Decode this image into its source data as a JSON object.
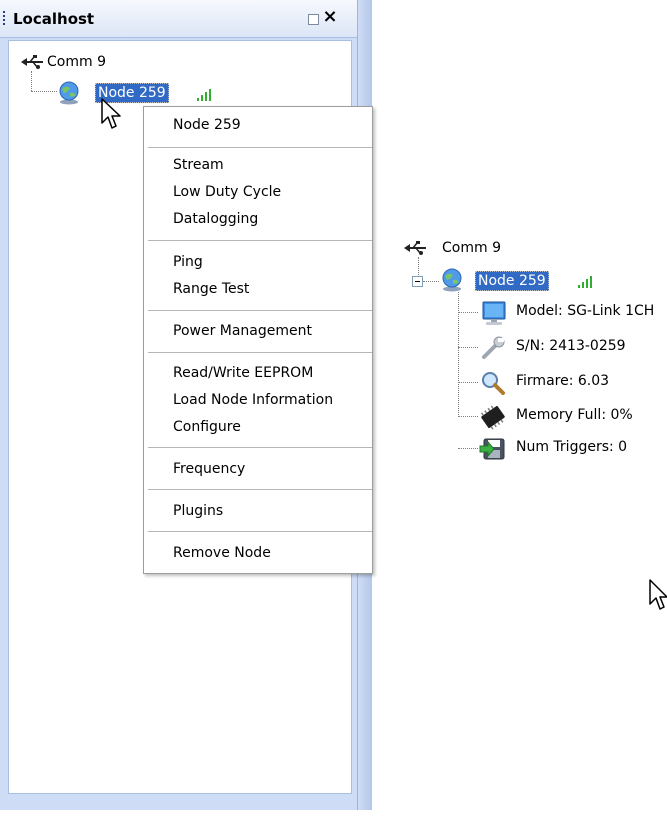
{
  "panel": {
    "title": "Localhost",
    "tree": {
      "port": "Comm 9",
      "node": "Node 259"
    }
  },
  "context_menu": {
    "header": "Node 259",
    "groups": [
      [
        "Stream",
        "Low Duty Cycle",
        "Datalogging"
      ],
      [
        "Ping",
        "Range Test"
      ],
      [
        "Power Management"
      ],
      [
        "Read/Write EEPROM",
        "Load Node Information",
        "Configure"
      ],
      [
        "Frequency"
      ],
      [
        "Plugins"
      ],
      [
        "Remove Node"
      ]
    ]
  },
  "expanded_tree": {
    "port": "Comm 9",
    "node": "Node 259",
    "children": [
      {
        "icon": "monitor-icon",
        "label": "Model: SG-Link 1CH"
      },
      {
        "icon": "wrench-icon",
        "label": "S/N: 2413-0259"
      },
      {
        "icon": "magnifier-icon",
        "label": "Firmare: 6.03"
      },
      {
        "icon": "memory-chip-icon",
        "label": "Memory Full: 0%"
      },
      {
        "icon": "trigger-disk-icon",
        "label": "Num Triggers: 0"
      }
    ]
  },
  "colors": {
    "selection": "#316ac5",
    "panel_frame": "#cfdcf5",
    "signal": "#2fae2f"
  }
}
